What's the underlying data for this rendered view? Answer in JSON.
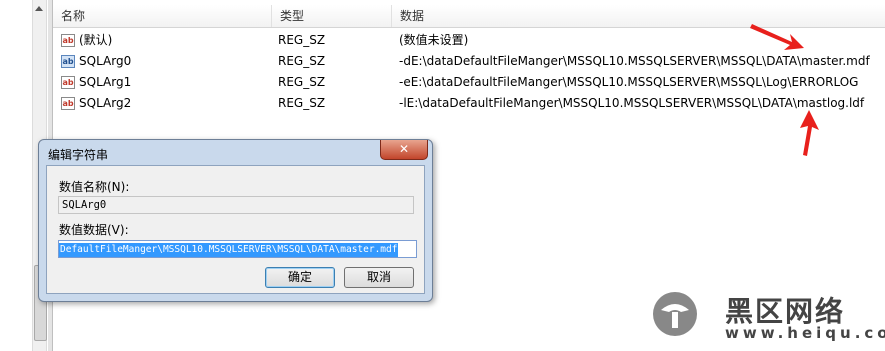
{
  "list": {
    "columns": [
      "名称",
      "类型",
      "数据"
    ],
    "rows": [
      {
        "name": "(默认)",
        "type": "REG_SZ",
        "data": "(数值未设置)"
      },
      {
        "name": "SQLArg0",
        "type": "REG_SZ",
        "data": "-dE:\\dataDefaultFileManger\\MSSQL10.MSSQLSERVER\\MSSQL\\DATA\\master.mdf"
      },
      {
        "name": "SQLArg1",
        "type": "REG_SZ",
        "data": "-eE:\\dataDefaultFileManger\\MSSQL10.MSSQLSERVER\\MSSQL\\Log\\ERRORLOG"
      },
      {
        "name": "SQLArg2",
        "type": "REG_SZ",
        "data": "-lE:\\dataDefaultFileManger\\MSSQL10.MSSQLSERVER\\MSSQL\\DATA\\mastlog.ldf"
      }
    ]
  },
  "dialog": {
    "title": "编辑字符串",
    "close_label": "✕",
    "value_name_label": "数值名称(N):",
    "value_name": "SQLArg0",
    "value_data_label": "数值数据(V):",
    "value_data": "DefaultFileManger\\MSSQL10.MSSQLSERVER\\MSSQL\\DATA\\master.mdf",
    "ok_label": "确定",
    "cancel_label": "取消"
  },
  "watermark": {
    "text": "黑区网络",
    "url": "www.heiqu.com"
  },
  "colors": {
    "arrow": "#e8201c",
    "selection": "#3399ff",
    "dialog_frame": "#c9d9ec"
  },
  "icons": [
    "string-value-icon",
    "close-icon",
    "heiqu-logo-icon",
    "red-arrow-annotation"
  ]
}
